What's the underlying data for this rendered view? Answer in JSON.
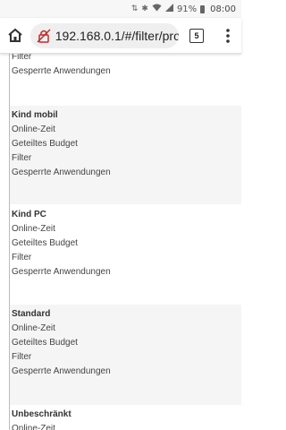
{
  "status_bar": {
    "battery_percent": "91%",
    "time": "08:00"
  },
  "browser": {
    "url": "192.168.0.1/#/filter/pro",
    "tab_count": "5"
  },
  "profiles": [
    {
      "name": "",
      "items": [
        "Filter",
        "Gesperrte Anwendungen"
      ]
    },
    {
      "name": "Kind mobil",
      "items": [
        "Online-Zeit",
        "Geteiltes Budget",
        "Filter",
        "Gesperrte Anwendungen"
      ]
    },
    {
      "name": "Kind PC",
      "items": [
        "Online-Zeit",
        "Geteiltes Budget",
        "Filter",
        "Gesperrte Anwendungen"
      ]
    },
    {
      "name": "Standard",
      "items": [
        "Online-Zeit",
        "Geteiltes Budget",
        "Filter",
        "Gesperrte Anwendungen"
      ]
    },
    {
      "name": "Unbeschränkt",
      "items": [
        "Online-Zeit"
      ]
    }
  ]
}
